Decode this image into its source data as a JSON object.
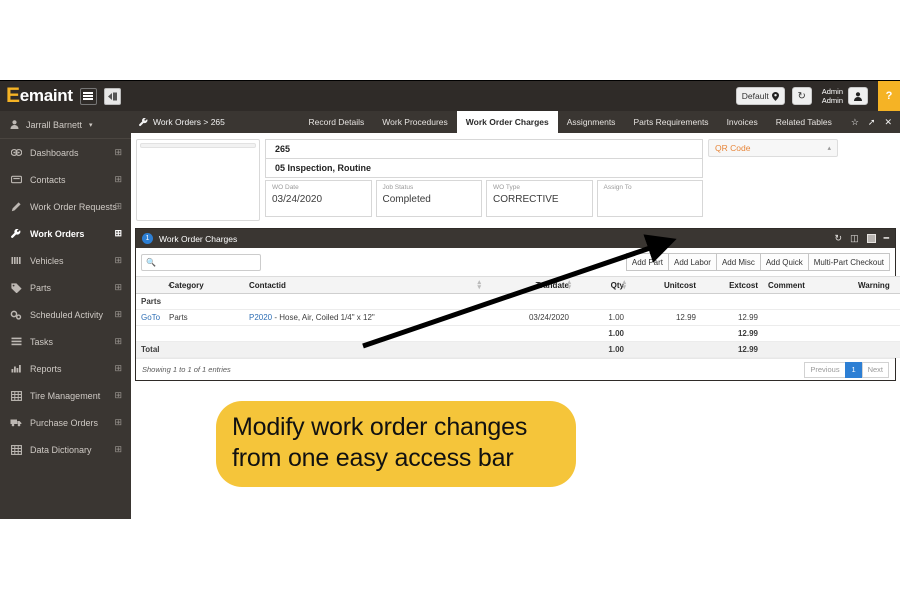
{
  "topbar": {
    "logo_text": "emaint",
    "logo_mark": "E",
    "menu_icon": "hamburger-icon",
    "collapse_icon": "collapse-panel-icon",
    "site_label": "Default",
    "site_icon": "location-pin-icon",
    "history_icon": "history-icon",
    "account_line1": "Admin",
    "account_line2": "Admin",
    "user_icon": "user-icon",
    "help_label": "?"
  },
  "sidebar": {
    "user": {
      "label": "Jarrall Barnett",
      "icon": "user-icon",
      "caret": "chevron-down-icon"
    },
    "items": [
      {
        "label": "Dashboards",
        "icon": "dashboard-icon",
        "expand": "plus-icon",
        "active": false
      },
      {
        "label": "Contacts",
        "icon": "contacts-icon",
        "expand": "plus-icon",
        "active": false
      },
      {
        "label": "Work Order Requests",
        "icon": "pencil-icon",
        "expand": "plus-icon",
        "active": false
      },
      {
        "label": "Work Orders",
        "icon": "wrench-icon",
        "expand": "plus-icon",
        "active": true
      },
      {
        "label": "Vehicles",
        "icon": "vehicles-icon",
        "expand": "plus-icon",
        "active": false
      },
      {
        "label": "Parts",
        "icon": "tag-icon",
        "expand": "plus-icon",
        "active": false
      },
      {
        "label": "Scheduled Activity",
        "icon": "gears-icon",
        "expand": "plus-icon",
        "active": false
      },
      {
        "label": "Tasks",
        "icon": "tasks-icon",
        "expand": "plus-icon",
        "active": false
      },
      {
        "label": "Reports",
        "icon": "bar-chart-icon",
        "expand": "plus-icon",
        "active": false
      },
      {
        "label": "Tire Management",
        "icon": "grid-icon",
        "expand": "plus-icon",
        "active": false
      },
      {
        "label": "Purchase Orders",
        "icon": "truck-icon",
        "expand": "plus-icon",
        "active": false
      },
      {
        "label": "Data Dictionary",
        "icon": "grid-icon",
        "expand": "plus-icon",
        "active": false
      }
    ]
  },
  "tabbar": {
    "breadcrumb": "Work Orders > 265",
    "breadcrumb_icon": "wrench-icon",
    "tabs": [
      {
        "label": "Record Details",
        "active": false
      },
      {
        "label": "Work Procedures",
        "active": false
      },
      {
        "label": "Work Order Charges",
        "active": true
      },
      {
        "label": "Assignments",
        "active": false
      },
      {
        "label": "Parts Requirements",
        "active": false
      },
      {
        "label": "Invoices",
        "active": false
      },
      {
        "label": "Related Tables",
        "active": false
      }
    ],
    "icons": [
      {
        "name": "star-icon",
        "glyph": "☆"
      },
      {
        "name": "expand-icon",
        "glyph": "⤢"
      },
      {
        "name": "close-icon",
        "glyph": "✕"
      }
    ]
  },
  "record": {
    "wo_number": "265",
    "wo_description": "05 Inspection, Routine",
    "fields": [
      {
        "label": "WO Date",
        "value": "03/24/2020"
      },
      {
        "label": "Job Status",
        "value": "Completed"
      },
      {
        "label": "WO Type",
        "value": "CORRECTIVE"
      },
      {
        "label": "Assign To",
        "value": ""
      }
    ],
    "qr_panel": {
      "title": "QR Code",
      "collapse_icon": "chevron-up-icon"
    }
  },
  "charges_panel": {
    "badge": "1",
    "title": "Work Order Charges",
    "icons": [
      {
        "name": "refresh-icon",
        "glyph": "↻"
      },
      {
        "name": "columns-icon",
        "glyph": "▥"
      },
      {
        "name": "maximize-icon",
        "glyph": ""
      },
      {
        "name": "minimize-icon",
        "glyph": "—"
      }
    ],
    "search": {
      "placeholder": "",
      "value": "",
      "icon": "search-icon"
    },
    "buttons": [
      "Add Part",
      "Add Labor",
      "Add Misc",
      "Add Quick",
      "Multi-Part Checkout"
    ],
    "columns": [
      {
        "label": "",
        "align": "left"
      },
      {
        "label": "Category",
        "align": "left"
      },
      {
        "label": "Contactid",
        "align": "left"
      },
      {
        "label": "Trandate",
        "align": "right"
      },
      {
        "label": "Qty",
        "align": "right"
      },
      {
        "label": "Unitcost",
        "align": "right"
      },
      {
        "label": "Extcost",
        "align": "right"
      },
      {
        "label": "Comment",
        "align": "left"
      },
      {
        "label": "Warning",
        "align": "left"
      }
    ],
    "group_label": "Parts",
    "rows": [
      {
        "goto": "GoTo",
        "category": "Parts",
        "part_id": "P2020",
        "part_desc": " - Hose, Air, Coiled 1/4\" x 12\"",
        "trandate": "03/24/2020",
        "qty": "1.00",
        "unitcost": "12.99",
        "extcost": "12.99",
        "comment": "",
        "warning": ""
      }
    ],
    "subtotal": {
      "qty": "1.00",
      "extcost": "12.99"
    },
    "total": {
      "label": "Total",
      "qty": "1.00",
      "extcost": "12.99"
    },
    "pager": {
      "info": "Showing 1 to 1 of 1 entries",
      "previous": "Previous",
      "current": "1",
      "next": "Next"
    }
  },
  "annotation": {
    "line1": "Modify work order changes",
    "line2": "from one easy access bar",
    "color": "#f5c53a",
    "arrow_color": "#000000"
  }
}
